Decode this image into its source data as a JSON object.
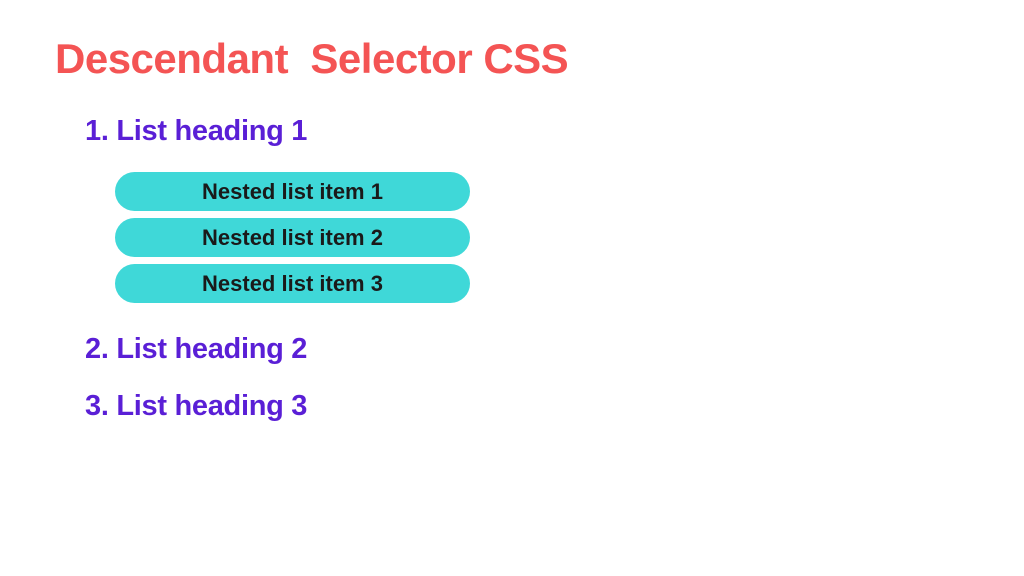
{
  "title": "Descendant  Selector CSS",
  "headings": [
    "1. List heading 1",
    "2. List heading 2",
    "3. List heading 3"
  ],
  "nested_items": [
    "Nested list item 1",
    "Nested list item 2",
    "Nested list item 3"
  ],
  "colors": {
    "title": "#f45454",
    "heading": "#5a1fd6",
    "pill_bg": "#3fd8d8",
    "pill_text": "#1a1a1a"
  }
}
